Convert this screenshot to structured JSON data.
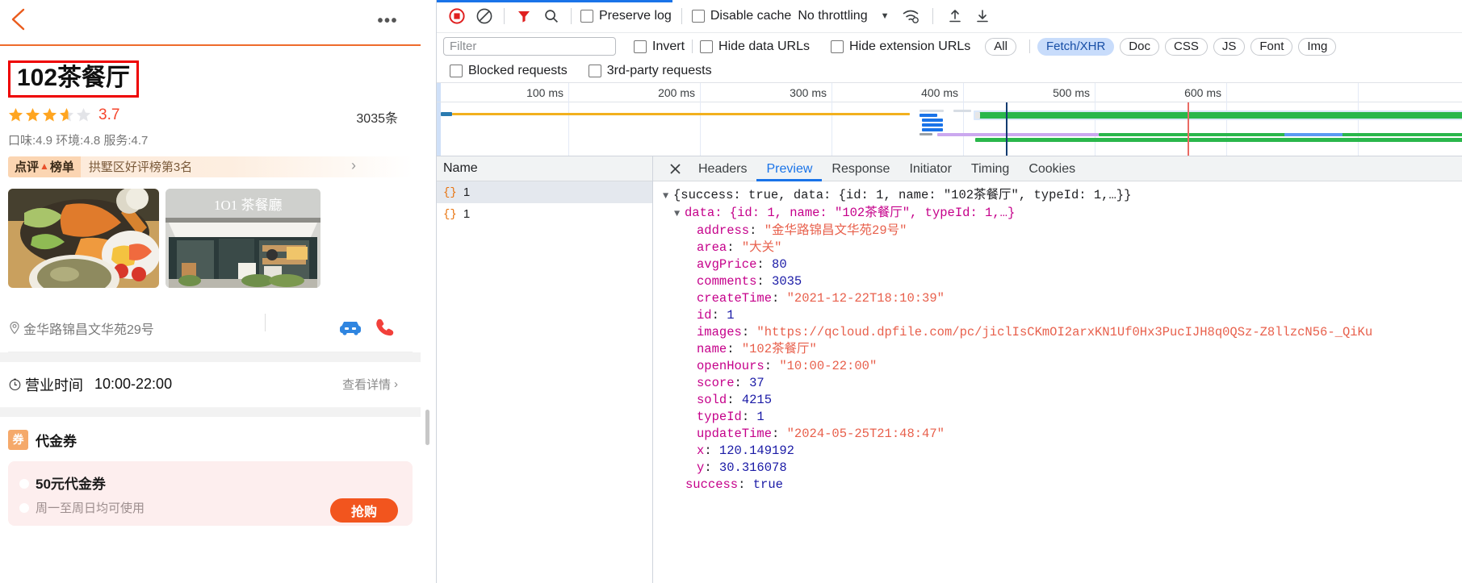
{
  "phone": {
    "back_icon": "back-chevron-icon",
    "more_icon": "more-dots-icon",
    "shop_name": "102茶餐厅",
    "score": "3.7",
    "comments_count": "3035条",
    "subratings": "口味:4.9 环境:4.8 服务:4.7",
    "rank_badge": "点评榜单",
    "rank_text": "拱墅区好评榜第3名",
    "address": "金华路锦昌文华苑29号",
    "hours_label": "营业时间",
    "hours_value": "10:00-22:00",
    "hours_more": "查看详情",
    "coupon_tag": "券",
    "coupon_section_title": "代金券",
    "coupon_title": "50元代金券",
    "coupon_sub": "周一至周日均可使用",
    "coupon_button": "抢购"
  },
  "devtools": {
    "toolbar": {
      "record_icon": "record-stop-icon",
      "clear_icon": "clear-icon",
      "filter_icon": "filter-funnel-icon",
      "search_icon": "search-icon",
      "preserve_log": "Preserve log",
      "disable_cache": "Disable cache",
      "throttling": "No throttling",
      "throttle_caret": "▼",
      "wifi_icon": "network-conditions-icon",
      "import_icon": "import-har-icon",
      "export_icon": "export-har-icon"
    },
    "filterbar": {
      "filter_placeholder": "Filter",
      "filter_value": "",
      "invert": "Invert",
      "hide_data_urls": "Hide data URLs",
      "hide_extension_urls": "Hide extension URLs",
      "chips": [
        "All",
        "Fetch/XHR",
        "Doc",
        "CSS",
        "JS",
        "Font",
        "Img"
      ],
      "selected_chip": "Fetch/XHR"
    },
    "blockedbar": {
      "blocked_requests": "Blocked requests",
      "third_party_requests": "3rd-party requests"
    },
    "overview": {
      "ticks": [
        "100 ms",
        "200 ms",
        "300 ms",
        "400 ms",
        "500 ms",
        "600 ms"
      ]
    },
    "names": {
      "header": "Name",
      "rows": [
        {
          "icon": "{}",
          "label": "1",
          "selected": true
        },
        {
          "icon": "{}",
          "label": "1",
          "selected": false
        }
      ]
    },
    "detail_tabs": {
      "close_icon": "close-icon",
      "tabs": [
        "Headers",
        "Preview",
        "Response",
        "Initiator",
        "Timing",
        "Cookies"
      ],
      "active": "Preview"
    },
    "preview": {
      "root_summary_prefix": "{success: ",
      "root_summary": "{success: true, data: {id: 1, name: \"102茶餐厅\", typeId: 1,…}}",
      "data_summary": "data: {id: 1, name: \"102茶餐厅\", typeId: 1,…}",
      "fields": [
        {
          "key": "address",
          "value": "\"金华路锦昌文华苑29号\"",
          "type": "str"
        },
        {
          "key": "area",
          "value": "\"大关\"",
          "type": "str"
        },
        {
          "key": "avgPrice",
          "value": "80",
          "type": "num"
        },
        {
          "key": "comments",
          "value": "3035",
          "type": "num"
        },
        {
          "key": "createTime",
          "value": "\"2021-12-22T18:10:39\"",
          "type": "str"
        },
        {
          "key": "id",
          "value": "1",
          "type": "num"
        },
        {
          "key": "images",
          "value": "\"https://qcloud.dpfile.com/pc/jiclIsCKmOI2arxKN1Uf0Hx3PucIJH8q0QSz-Z8llzcN56-_QiKu",
          "type": "str"
        },
        {
          "key": "name",
          "value": "\"102茶餐厅\"",
          "type": "str"
        },
        {
          "key": "openHours",
          "value": "\"10:00-22:00\"",
          "type": "str"
        },
        {
          "key": "score",
          "value": "37",
          "type": "num"
        },
        {
          "key": "sold",
          "value": "4215",
          "type": "num"
        },
        {
          "key": "typeId",
          "value": "1",
          "type": "num"
        },
        {
          "key": "updateTime",
          "value": "\"2024-05-25T21:48:47\"",
          "type": "str"
        },
        {
          "key": "x",
          "value": "120.149192",
          "type": "num"
        },
        {
          "key": "y",
          "value": "30.316078",
          "type": "num"
        }
      ],
      "tail": {
        "key": "success",
        "value": "true",
        "type": "bool"
      }
    }
  }
}
